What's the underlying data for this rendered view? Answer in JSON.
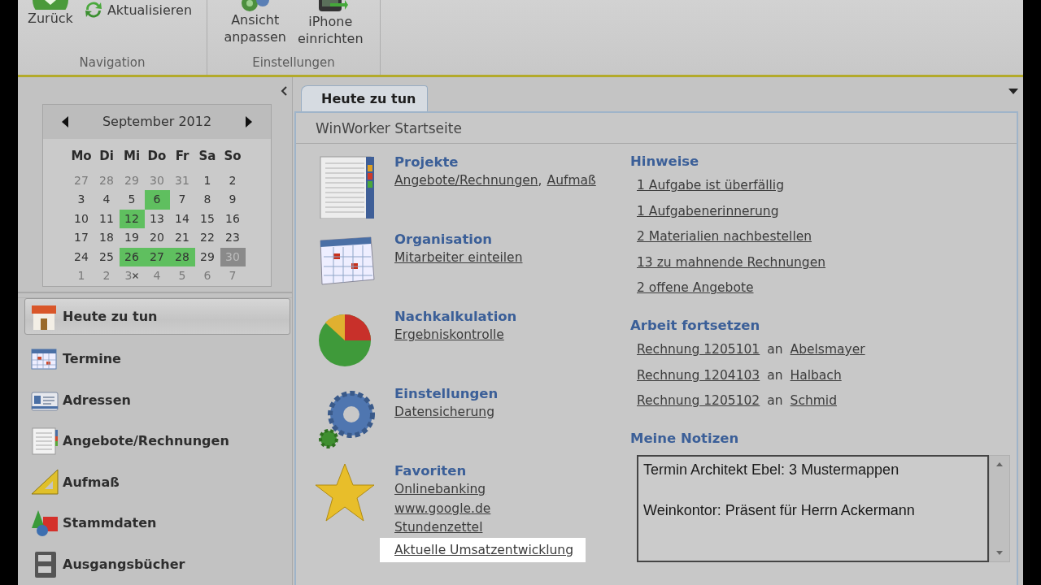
{
  "ribbon": {
    "groups": [
      {
        "label": "Navigation",
        "buttons": [
          {
            "lines": [
              "Zurück"
            ],
            "kind": "large"
          },
          {
            "lines": [
              "Aktualisieren"
            ],
            "kind": "small"
          }
        ]
      },
      {
        "label": "Einstellungen",
        "buttons": [
          {
            "lines": [
              "Ansicht",
              "anpassen"
            ],
            "kind": "large"
          },
          {
            "lines": [
              "iPhone",
              "einrichten"
            ],
            "kind": "large"
          }
        ]
      }
    ]
  },
  "calendar": {
    "title": "September 2012",
    "weekdays": [
      "Mo",
      "Di",
      "Mi",
      "Do",
      "Fr",
      "Sa",
      "So"
    ],
    "weeks": [
      [
        {
          "label": "27",
          "kind": "muted"
        },
        {
          "label": "28",
          "kind": "muted"
        },
        {
          "label": "29",
          "kind": "muted"
        },
        {
          "label": "30",
          "kind": "muted"
        },
        {
          "label": "31",
          "kind": "muted"
        },
        {
          "label": "1",
          "kind": "normal"
        },
        {
          "label": "2",
          "kind": "normal"
        }
      ],
      [
        {
          "label": "3",
          "kind": "normal"
        },
        {
          "label": "4",
          "kind": "normal"
        },
        {
          "label": "5",
          "kind": "normal"
        },
        {
          "label": "6",
          "kind": "marked"
        },
        {
          "label": "7",
          "kind": "normal"
        },
        {
          "label": "8",
          "kind": "normal"
        },
        {
          "label": "9",
          "kind": "normal"
        }
      ],
      [
        {
          "label": "10",
          "kind": "normal"
        },
        {
          "label": "11",
          "kind": "normal"
        },
        {
          "label": "12",
          "kind": "marked"
        },
        {
          "label": "13",
          "kind": "normal"
        },
        {
          "label": "14",
          "kind": "normal"
        },
        {
          "label": "15",
          "kind": "normal"
        },
        {
          "label": "16",
          "kind": "normal"
        }
      ],
      [
        {
          "label": "17",
          "kind": "normal"
        },
        {
          "label": "18",
          "kind": "normal"
        },
        {
          "label": "19",
          "kind": "normal"
        },
        {
          "label": "20",
          "kind": "normal"
        },
        {
          "label": "21",
          "kind": "normal"
        },
        {
          "label": "22",
          "kind": "normal"
        },
        {
          "label": "23",
          "kind": "normal"
        }
      ],
      [
        {
          "label": "24",
          "kind": "normal"
        },
        {
          "label": "25",
          "kind": "normal"
        },
        {
          "label": "26",
          "kind": "marked"
        },
        {
          "label": "27",
          "kind": "marked"
        },
        {
          "label": "28",
          "kind": "marked"
        },
        {
          "label": "29",
          "kind": "normal"
        },
        {
          "label": "30",
          "kind": "today"
        }
      ],
      [
        {
          "label": "1",
          "kind": "muted"
        },
        {
          "label": "2",
          "kind": "muted"
        },
        {
          "label": "3",
          "kind": "crossed"
        },
        {
          "label": "4",
          "kind": "muted"
        },
        {
          "label": "5",
          "kind": "muted"
        },
        {
          "label": "6",
          "kind": "muted"
        },
        {
          "label": "7",
          "kind": "muted"
        }
      ]
    ]
  },
  "sidebar": {
    "items": [
      {
        "label": "Heute zu tun",
        "selected": true
      },
      {
        "label": "Termine",
        "selected": false
      },
      {
        "label": "Adressen",
        "selected": false
      },
      {
        "label": "Angebote/Rechnungen",
        "selected": false
      },
      {
        "label": "Aufmaß",
        "selected": false
      },
      {
        "label": "Stammdaten",
        "selected": false
      },
      {
        "label": "Ausgangsbücher",
        "selected": false
      }
    ]
  },
  "tabs": [
    {
      "label": "Heute zu tun",
      "selected": true
    }
  ],
  "page": {
    "title": "WinWorker Startseite",
    "sections": [
      {
        "title": "Projekte",
        "separator": ",",
        "links": [
          {
            "text": "Angebote/Rechnungen",
            "highlighted": false
          },
          {
            "text": "Aufmaß",
            "highlighted": false
          }
        ]
      },
      {
        "title": "Organisation",
        "links": [
          {
            "text": "Mitarbeiter einteilen",
            "highlighted": false
          }
        ]
      },
      {
        "title": "Nachkalkulation",
        "links": [
          {
            "text": "Ergebniskontrolle",
            "highlighted": false
          }
        ]
      },
      {
        "title": "Einstellungen",
        "links": [
          {
            "text": "Datensicherung",
            "highlighted": false
          }
        ]
      },
      {
        "title": "Favoriten",
        "links": [
          {
            "text": "Onlinebanking",
            "highlighted": false
          },
          {
            "text": "www.google.de",
            "highlighted": false
          },
          {
            "text": "Stundenzettel",
            "highlighted": false
          },
          {
            "text": "Aktuelle Umsatzentwicklung",
            "highlighted": true
          }
        ]
      }
    ],
    "hints": {
      "title": "Hinweise",
      "links": [
        "1 Aufgabe ist überfällig",
        "1 Aufgabenerinnerung",
        "2 Materialien nachbestellen",
        "13 zu mahnende Rechnungen",
        "2 offene Angebote"
      ]
    },
    "resume": {
      "title": "Arbeit fortsetzen",
      "rows": [
        {
          "document": "Rechnung 1205101",
          "connector": "an",
          "customer": "Abelsmayer"
        },
        {
          "document": "Rechnung 1204103",
          "connector": "an",
          "customer": "Halbach"
        },
        {
          "document": "Rechnung 1205102",
          "connector": "an",
          "customer": "Schmid"
        }
      ]
    },
    "notes": {
      "title": "Meine Notizen",
      "value": "Termin Architekt Ebel: 3 Mustermappen\n\nWeinkontor: Präsent für Herrn Ackermann"
    }
  }
}
